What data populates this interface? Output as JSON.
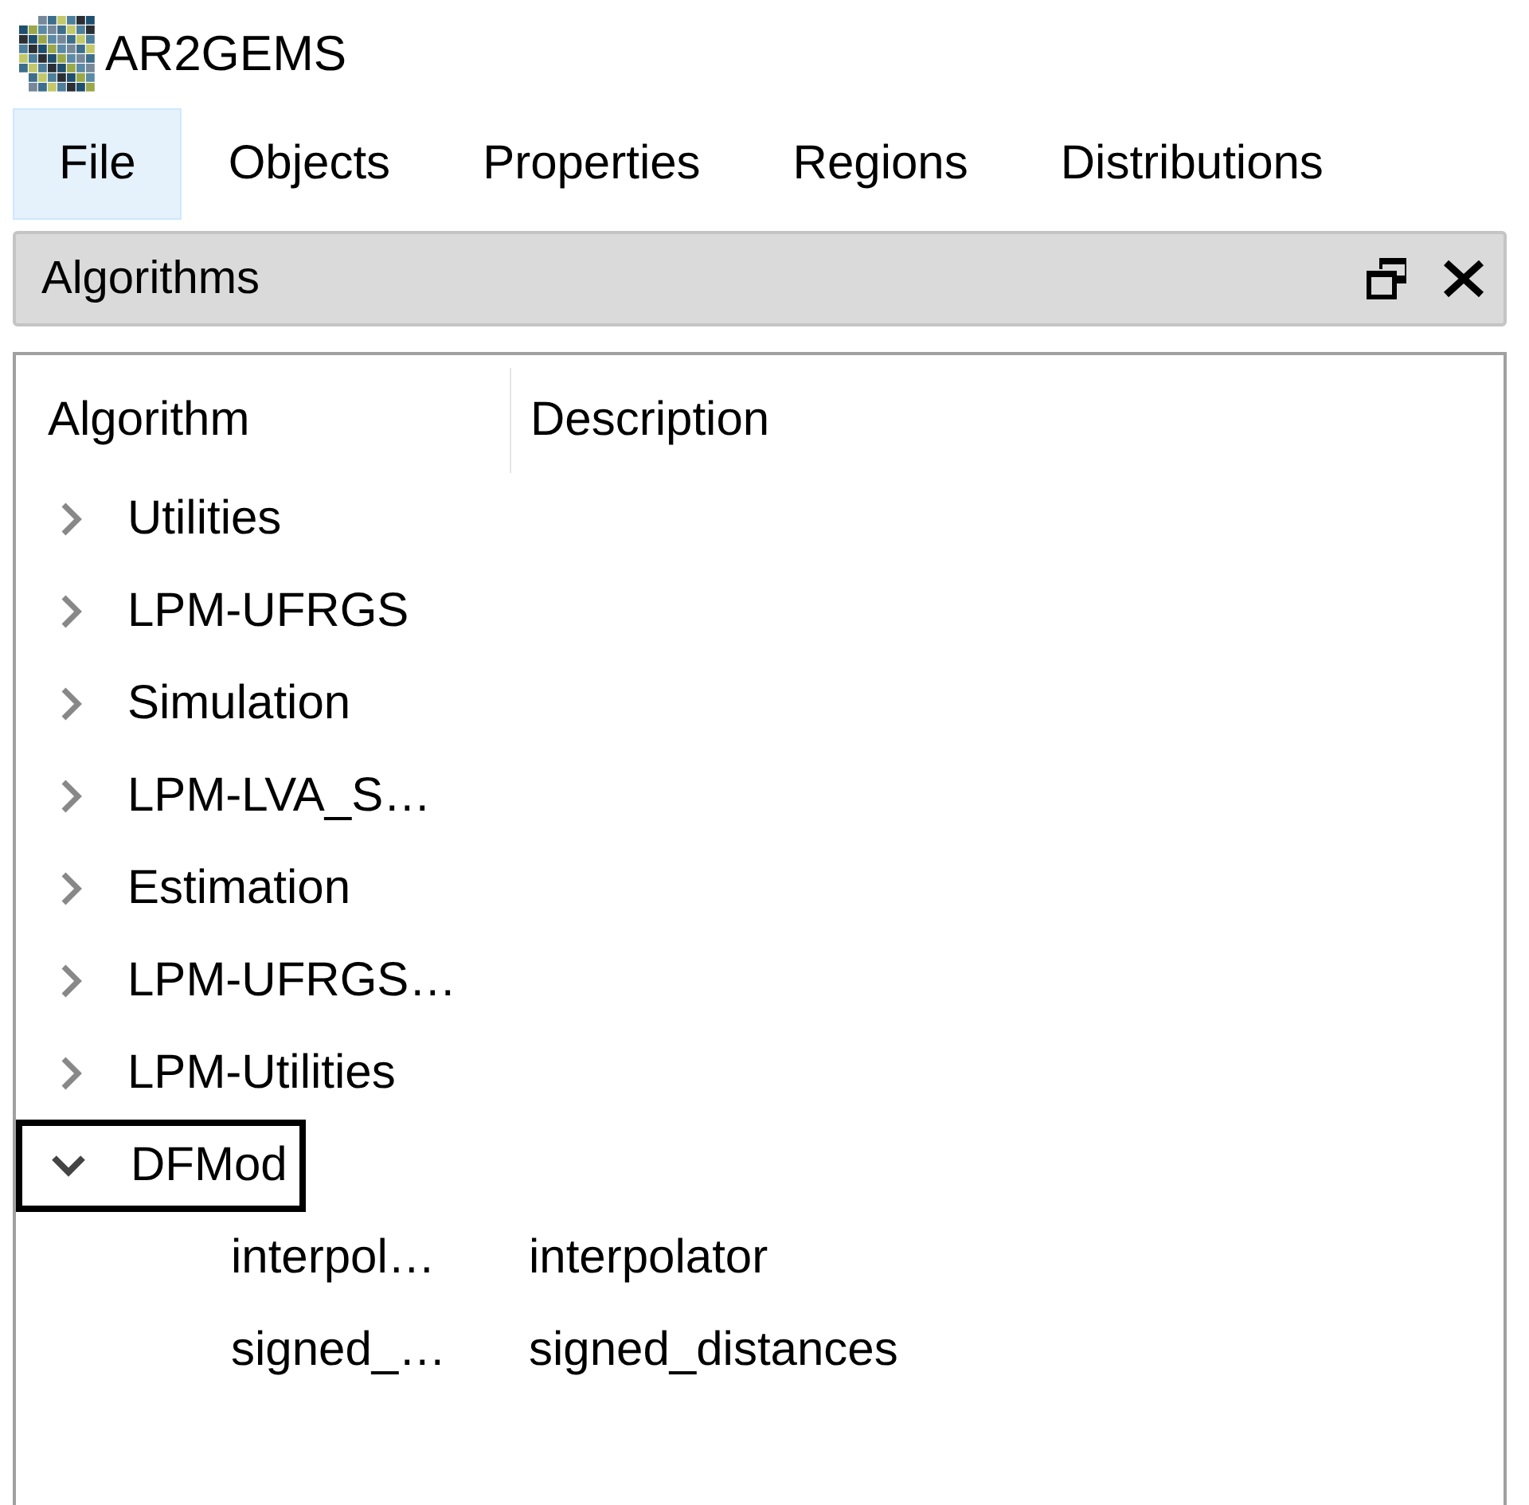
{
  "window": {
    "title": "AR2GEMS"
  },
  "menu": [
    {
      "label": "File",
      "selected": true
    },
    {
      "label": "Objects",
      "selected": false
    },
    {
      "label": "Properties",
      "selected": false
    },
    {
      "label": "Regions",
      "selected": false
    },
    {
      "label": "Distributions",
      "selected": false
    }
  ],
  "dock": {
    "title": "Algorithms"
  },
  "tree": {
    "columns": [
      "Algorithm",
      "Description"
    ],
    "items": [
      {
        "name": "Utilities",
        "expanded": false,
        "selected": false
      },
      {
        "name": "LPM-UFRGS",
        "expanded": false,
        "selected": false
      },
      {
        "name": "Simulation",
        "expanded": false,
        "selected": false
      },
      {
        "name": "LPM-LVA_S…",
        "expanded": false,
        "selected": false
      },
      {
        "name": "Estimation",
        "expanded": false,
        "selected": false
      },
      {
        "name": "LPM-UFRGS…",
        "expanded": false,
        "selected": false
      },
      {
        "name": "LPM-Utilities",
        "expanded": false,
        "selected": false
      },
      {
        "name": "DFMod",
        "expanded": true,
        "selected": true,
        "children": [
          {
            "name": "interpol…",
            "description": "interpolator"
          },
          {
            "name": "signed_…",
            "description": "signed_distances"
          }
        ]
      }
    ]
  }
}
